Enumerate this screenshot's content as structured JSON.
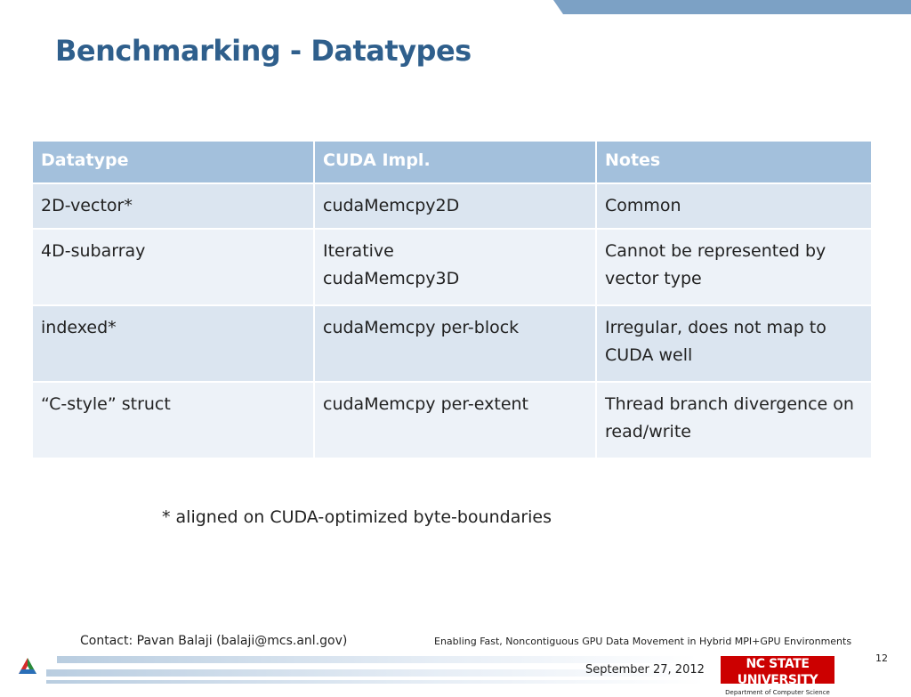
{
  "slide": {
    "title": "Benchmarking - Datatypes",
    "accent_color": "#2f5f8c",
    "header_band_color": "#7ca1c5"
  },
  "table": {
    "headers": [
      "Datatype",
      "CUDA Impl.",
      "Notes"
    ],
    "rows": [
      [
        "2D-vector*",
        "cudaMemcpy2D",
        "Common"
      ],
      [
        "4D-subarray",
        "Iterative cudaMemcpy3D",
        "Cannot be represented by vector type"
      ],
      [
        "indexed*",
        "cudaMemcpy per-block",
        "Irregular, does not map to CUDA well"
      ],
      [
        "“C-style” struct",
        "cudaMemcpy per-extent",
        "Thread branch divergence on read/write"
      ]
    ]
  },
  "footnote": "* aligned on CUDA-optimized byte-boundaries",
  "footer": {
    "contact": "Contact: Pavan Balaji (balaji@mcs.anl.gov)",
    "presentation_title": "Enabling Fast, Noncontiguous GPU Data Movement in Hybrid MPI+GPU Environments",
    "date": "September 27, 2012",
    "page_number": "12",
    "university_logo_top": "NC STATE UNIVERSITY",
    "university_logo_bottom": "Department of Computer Science",
    "logo_icon": "argonne-triangle-logo"
  }
}
